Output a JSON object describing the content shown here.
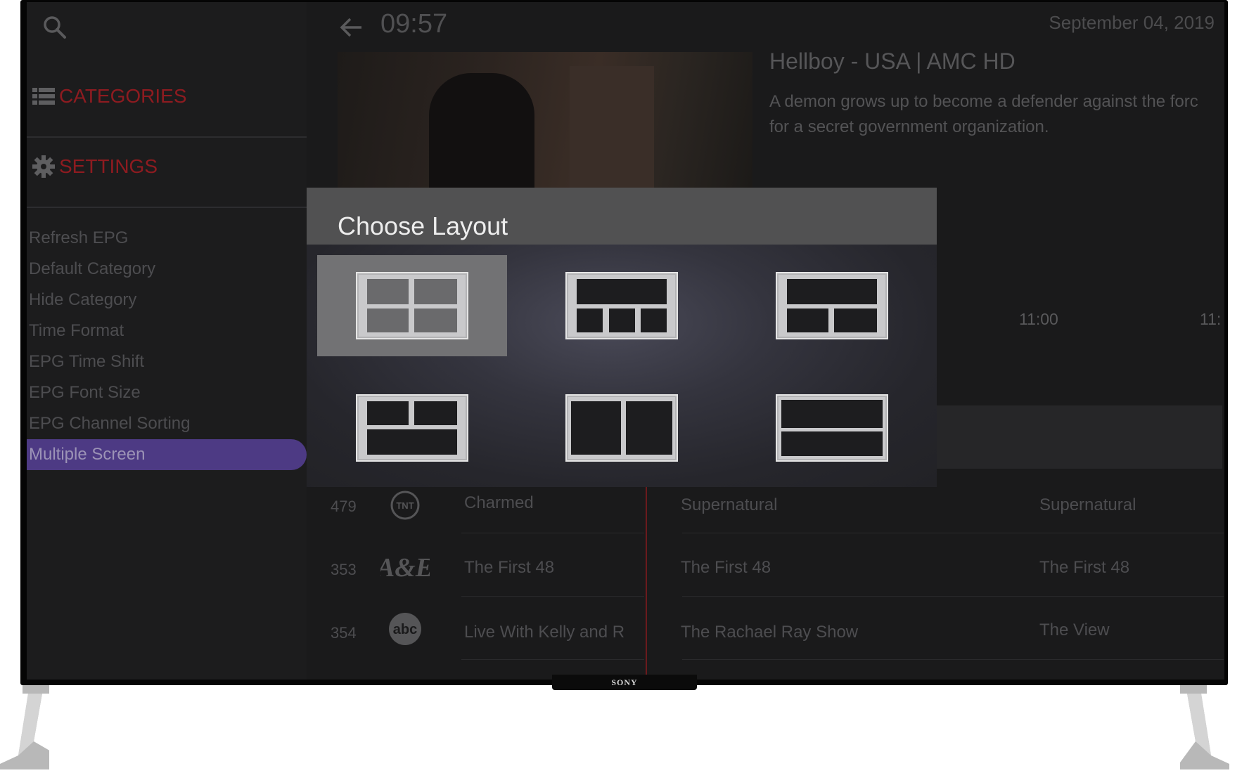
{
  "header": {
    "time": "09:57",
    "date": "September 04, 2019"
  },
  "sidebar": {
    "categories_label": "CATEGORIES",
    "settings_label": "SETTINGS",
    "items": [
      {
        "label": "Refresh EPG"
      },
      {
        "label": "Default Category"
      },
      {
        "label": "Hide Category"
      },
      {
        "label": "Time Format"
      },
      {
        "label": "EPG Time Shift"
      },
      {
        "label": "EPG Font Size"
      },
      {
        "label": "EPG Channel Sorting"
      },
      {
        "label": "Multiple Screen",
        "active": true
      }
    ]
  },
  "program": {
    "title": "Hellboy - USA | AMC HD",
    "description_line1": "A demon grows up to become a defender against the forc",
    "description_line2": "for a secret government organization."
  },
  "timeline": {
    "slot_1": "11:00",
    "slot_2": "11:"
  },
  "epg_rows": [
    {
      "number": "479",
      "logo": "tnt-logo",
      "current": "Charmed",
      "next": "Supernatural",
      "later": "Supernatural"
    },
    {
      "number": "353",
      "logo": "ae-logo",
      "current": "The First 48",
      "next": "The First 48",
      "later": "The First 48"
    },
    {
      "number": "354",
      "logo": "abc-logo",
      "current": "Live With Kelly and R",
      "next": "The Rachael Ray Show",
      "later": "The View"
    }
  ],
  "modal": {
    "title": "Choose Layout",
    "options": [
      {
        "name": "quad-grid",
        "selected": true
      },
      {
        "name": "one-top-three-bottom"
      },
      {
        "name": "one-top-two-bottom"
      },
      {
        "name": "two-top-one-bottom"
      },
      {
        "name": "side-by-side"
      },
      {
        "name": "stacked"
      }
    ]
  },
  "device": {
    "brand": "SONY"
  },
  "colors": {
    "accent_red": "#8e1b20",
    "active_item": "#4d3a84",
    "modal_header": "#515152"
  }
}
